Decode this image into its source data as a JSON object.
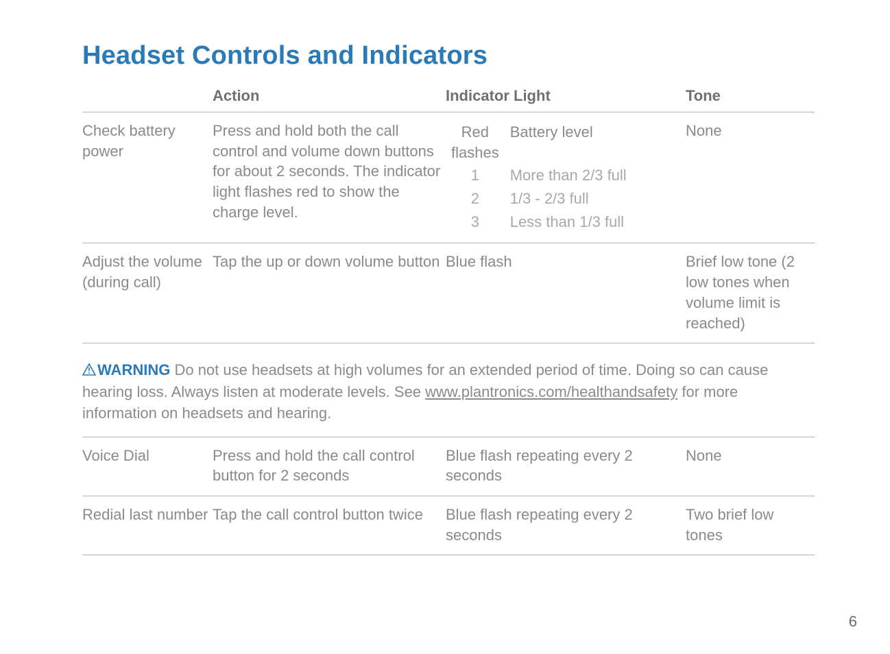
{
  "title": "Headset Controls and Indicators",
  "headers": {
    "name": "",
    "action": "Action",
    "indicator": "Indicator Light",
    "tone": "Tone"
  },
  "rows_top": [
    {
      "name": "Check battery power",
      "action": "Press and hold both the call control and volume down buttons for about 2 seconds. The indicator light flashes red to show the charge level.",
      "indicator_table": {
        "col1_header": "Red flashes",
        "col2_header": "Battery level",
        "rows": [
          {
            "n": "1",
            "v": "More than 2/3 full"
          },
          {
            "n": "2",
            "v": "1/3 - 2/3 full"
          },
          {
            "n": "3",
            "v": "Less than 1/3 full"
          }
        ]
      },
      "tone": "None"
    },
    {
      "name": "Adjust the volume (during call)",
      "action": "Tap the up or down volume button",
      "indicator": "Blue flash",
      "tone": "Brief low tone (2 low tones when volume limit is reached)"
    }
  ],
  "warning": {
    "label": "WARNING",
    "text_before": "Do not use headsets at high volumes for an extended period of time. Doing so can cause hearing loss. Always listen at moderate levels. See ",
    "link_text": "www.plantronics.com/healthandsafety",
    "text_after": " for more information on headsets and hearing."
  },
  "rows_bottom": [
    {
      "name": "Voice Dial",
      "action": "Press and hold the call control button for 2 seconds",
      "indicator": "Blue flash repeating every 2 seconds",
      "tone": "None"
    },
    {
      "name": "Redial last number",
      "action": "Tap the call control button twice",
      "indicator": "Blue flash repeating every 2 seconds",
      "tone": "Two brief low tones"
    }
  ],
  "page_number": "6"
}
